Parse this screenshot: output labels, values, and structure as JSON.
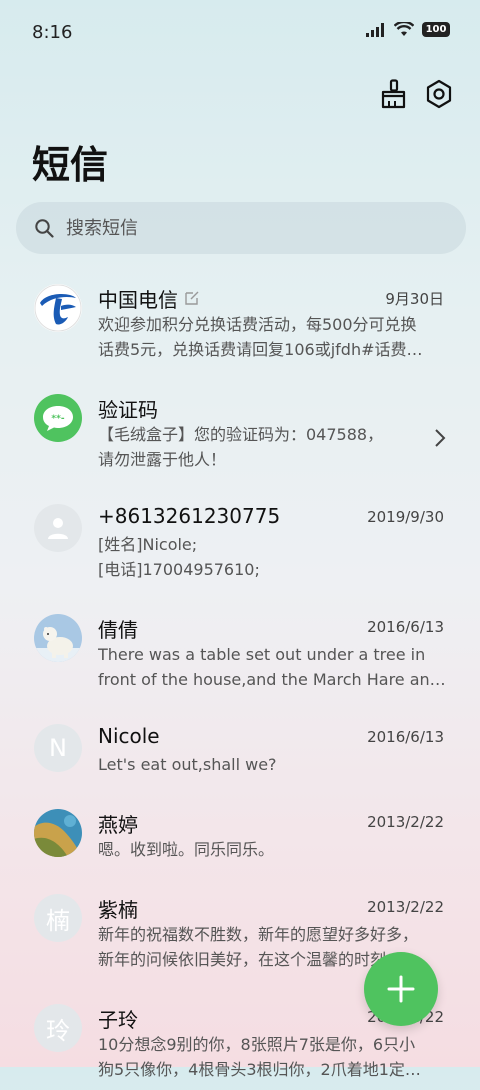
{
  "status_bar": {
    "time": "8:16",
    "battery": "100"
  },
  "header": {
    "title": "短信",
    "actions": [
      {
        "icon": "broom-icon"
      },
      {
        "icon": "settings-icon"
      }
    ]
  },
  "search": {
    "placeholder": "搜索短信"
  },
  "messages": [
    {
      "name": "中国电信",
      "date": "9月30日",
      "lines": [
        "欢迎参加积分兑换话费活动，每500分可兑换",
        "话费5元，兑换话费请回复106或jfdh#话费…"
      ],
      "avatar": "telecom-logo"
    },
    {
      "name": "验证码",
      "date": "",
      "lines": [
        "【毛绒盒子】您的验证码为：047588，",
        "请勿泄露于他人！"
      ],
      "avatar": "verification-code-icon"
    },
    {
      "name": "+8613261230775",
      "date": "2019/9/30",
      "lines": [
        "[姓名]Nicole;",
        "[电话]17004957610;"
      ],
      "avatar": "person-icon"
    },
    {
      "name": "倩倩",
      "date": "2016/6/13",
      "lines": [
        "There was a table set out under a tree in",
        "front of the house,and the March Hare an…"
      ],
      "avatar": "polar-bear-photo"
    },
    {
      "name": "Nicole",
      "date": "2016/6/13",
      "lines": [
        "Let's eat out,shall we?"
      ],
      "avatar_letter": "N"
    },
    {
      "name": "燕婷",
      "date": "2013/2/22",
      "lines": [
        "嗯。收到啦。同乐同乐。"
      ],
      "avatar": "landscape-photo"
    },
    {
      "name": "紫楠",
      "date": "2013/2/22",
      "lines": [
        "新年的祝福数不胜数，新年的愿望好多好多，",
        "新年的问候依旧美好，在这个温馨的时刻…"
      ],
      "avatar_letter": "楠"
    },
    {
      "name": "子玲",
      "date": "2013/2/22",
      "lines": [
        "10分想念9别的你，8张照片7张是你，6只小",
        "狗5只像你，4根骨头3根归你，2爪着地1定…"
      ],
      "avatar_letter": "玲"
    }
  ],
  "colors": {
    "accent": "#4fc35f",
    "telecom_blue": "#1a5bb5"
  }
}
